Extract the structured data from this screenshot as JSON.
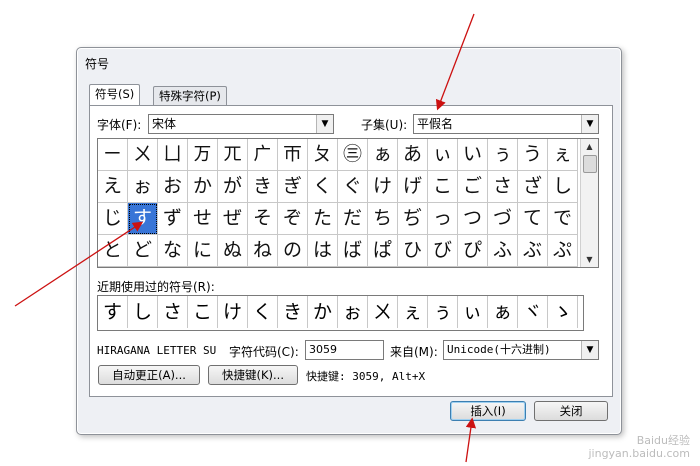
{
  "dialog": {
    "title": "符号",
    "tabs": [
      {
        "label": "符号(S)"
      },
      {
        "label": "特殊字符(P)"
      }
    ],
    "font_label": "字体(F):",
    "font_value": "宋体",
    "subset_label": "子集(U):",
    "subset_value": "平假名",
    "grid_rows": [
      [
        "ㄧ",
        "ㄨ",
        "ㄩ",
        "ㄪ",
        "ㄫ",
        "ㄬ",
        "ㄭ",
        "ㄆ",
        "㊂",
        "ぁ",
        "あ",
        "ぃ",
        "い",
        "ぅ",
        "う",
        "ぇ"
      ],
      [
        "え",
        "ぉ",
        "お",
        "か",
        "が",
        "き",
        "ぎ",
        "く",
        "ぐ",
        "け",
        "げ",
        "こ",
        "ご",
        "さ",
        "ざ",
        "し"
      ],
      [
        "じ",
        "す",
        "ず",
        "せ",
        "ぜ",
        "そ",
        "ぞ",
        "た",
        "だ",
        "ち",
        "ぢ",
        "っ",
        "つ",
        "づ",
        "て",
        "で"
      ],
      [
        "と",
        "ど",
        "な",
        "に",
        "ぬ",
        "ね",
        "の",
        "は",
        "ば",
        "ぱ",
        "ひ",
        "び",
        "ぴ",
        "ふ",
        "ぶ",
        "ぷ"
      ]
    ],
    "selected_char": "す",
    "recent_label": "近期使用过的符号(R):",
    "recent_symbols": [
      "す",
      "し",
      "さ",
      "こ",
      "け",
      "く",
      "き",
      "か",
      "ぉ",
      "ㄨ",
      "ぇ",
      "ぅ",
      "ぃ",
      "ぁ",
      "ヾ",
      "ゝ"
    ],
    "char_name": "HIRAGANA LETTER SU",
    "char_code_label": "字符代码(C):",
    "char_code_value": "3059",
    "from_label": "来自(M):",
    "from_value": "Unicode(十六进制)",
    "autocorrect_button": "自动更正(A)...",
    "shortcut_button": "快捷键(K)...",
    "shortcut_text": "快捷键: 3059, Alt+X",
    "insert_button": "插入(I)",
    "close_button": "关闭"
  },
  "watermark": {
    "line1": "Baidu经验",
    "line2": "jingyan.baidu.com"
  },
  "colors": {
    "selection": "#3875d7",
    "annotation_arrow": "#cc1111"
  }
}
